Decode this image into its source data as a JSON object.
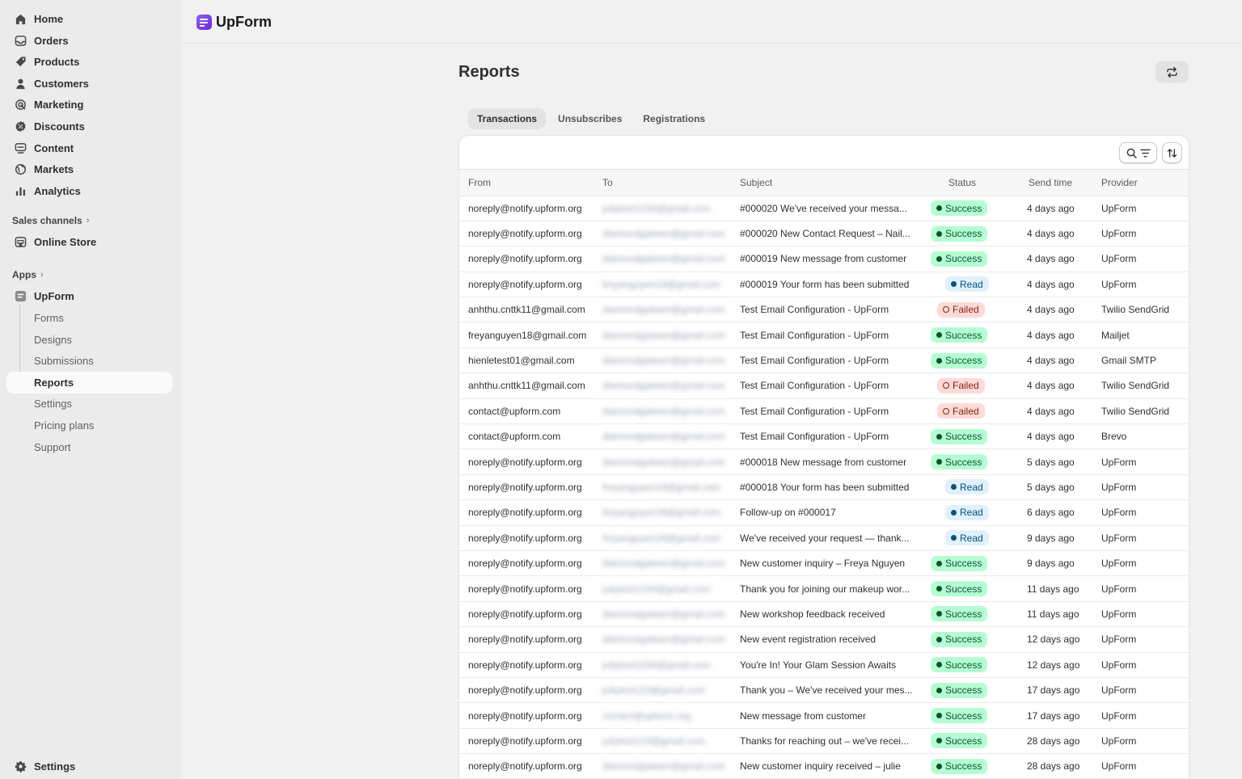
{
  "app": {
    "name": "UpForm"
  },
  "sidebar": {
    "main_items": [
      {
        "label": "Home",
        "icon": "home-icon"
      },
      {
        "label": "Orders",
        "icon": "inbox-icon"
      },
      {
        "label": "Products",
        "icon": "tag-icon"
      },
      {
        "label": "Customers",
        "icon": "person-icon"
      },
      {
        "label": "Marketing",
        "icon": "target-icon"
      },
      {
        "label": "Discounts",
        "icon": "discount-icon"
      },
      {
        "label": "Content",
        "icon": "content-icon"
      },
      {
        "label": "Markets",
        "icon": "globe-icon"
      },
      {
        "label": "Analytics",
        "icon": "bar-chart-icon"
      }
    ],
    "sales_channels_label": "Sales channels",
    "online_store_label": "Online Store",
    "apps_label": "Apps",
    "app_item_label": "UpForm",
    "app_sub_items": [
      "Forms",
      "Designs",
      "Submissions",
      "Reports",
      "Settings",
      "Pricing plans",
      "Support"
    ],
    "active_sub_item": "Reports",
    "settings_label": "Settings"
  },
  "page": {
    "title": "Reports",
    "tabs": [
      "Transactions",
      "Unsubscribes",
      "Registrations"
    ],
    "active_tab": "Transactions"
  },
  "table": {
    "headers": {
      "from": "From",
      "to": "To",
      "subject": "Subject",
      "status": "Status",
      "send_time": "Send time",
      "provider": "Provider"
    },
    "rows": [
      {
        "from": "noreply@notify.upform.org",
        "to": "juliytest1234@gmail.com",
        "subject": "#000020 We've received your messa...",
        "status": "Success",
        "send_time": "4 days ago",
        "provider": "UpForm"
      },
      {
        "from": "noreply@notify.upform.org",
        "to": "diamondgatewn@gmail.com",
        "subject": "#000020 New Contact Request – Nail...",
        "status": "Success",
        "send_time": "4 days ago",
        "provider": "UpForm"
      },
      {
        "from": "noreply@notify.upform.org",
        "to": "diamondgatewn@gmail.com",
        "subject": "#000019 New message from customer",
        "status": "Success",
        "send_time": "4 days ago",
        "provider": "UpForm"
      },
      {
        "from": "noreply@notify.upform.org",
        "to": "freyanguyen18@gmail.com",
        "subject": "#000019 Your form has been submitted",
        "status": "Read",
        "send_time": "4 days ago",
        "provider": "UpForm"
      },
      {
        "from": "anhthu.cnttk11@gmail.com",
        "to": "diamondgatewn@gmail.com",
        "subject": "Test Email Configuration - UpForm",
        "status": "Failed",
        "send_time": "4 days ago",
        "provider": "Twilio SendGrid"
      },
      {
        "from": "freyanguyen18@gmail.com",
        "to": "diamondgatewn@gmail.com",
        "subject": "Test Email Configuration - UpForm",
        "status": "Success",
        "send_time": "4 days ago",
        "provider": "Mailjet"
      },
      {
        "from": "hienletest01@gmail.com",
        "to": "diamondgatewn@gmail.com",
        "subject": "Test Email Configuration - UpForm",
        "status": "Success",
        "send_time": "4 days ago",
        "provider": "Gmail SMTP"
      },
      {
        "from": "anhthu.cnttk11@gmail.com",
        "to": "diamondgatewn@gmail.com",
        "subject": "Test Email Configuration - UpForm",
        "status": "Failed",
        "send_time": "4 days ago",
        "provider": "Twilio SendGrid"
      },
      {
        "from": "contact@upform.com",
        "to": "diamondgatewn@gmail.com",
        "subject": "Test Email Configuration - UpForm",
        "status": "Failed",
        "send_time": "4 days ago",
        "provider": "Twilio SendGrid"
      },
      {
        "from": "contact@upform.com",
        "to": "diamondgatewn@gmail.com",
        "subject": "Test Email Configuration - UpForm",
        "status": "Success",
        "send_time": "4 days ago",
        "provider": "Brevo"
      },
      {
        "from": "noreply@notify.upform.org",
        "to": "diamondgatewn@gmail.com",
        "subject": "#000018 New message from customer",
        "status": "Success",
        "send_time": "5 days ago",
        "provider": "UpForm"
      },
      {
        "from": "noreply@notify.upform.org",
        "to": "freyanguyen18@gmail.com",
        "subject": "#000018 Your form has been submitted",
        "status": "Read",
        "send_time": "5 days ago",
        "provider": "UpForm"
      },
      {
        "from": "noreply@notify.upform.org",
        "to": "freyanguyen18@gmail.com",
        "subject": "Follow-up on #000017",
        "status": "Read",
        "send_time": "6 days ago",
        "provider": "UpForm"
      },
      {
        "from": "noreply@notify.upform.org",
        "to": "freyanguyen18@gmail.com",
        "subject": "We've received your request — thank...",
        "status": "Read",
        "send_time": "9 days ago",
        "provider": "UpForm"
      },
      {
        "from": "noreply@notify.upform.org",
        "to": "diamondgatewn@gmail.com",
        "subject": "New customer inquiry – Freya Nguyen",
        "status": "Success",
        "send_time": "9 days ago",
        "provider": "UpForm"
      },
      {
        "from": "noreply@notify.upform.org",
        "to": "juliytest1234@gmail.com",
        "subject": "Thank you for joining our makeup wor...",
        "status": "Success",
        "send_time": "11 days ago",
        "provider": "UpForm"
      },
      {
        "from": "noreply@notify.upform.org",
        "to": "diamondgatewn@gmail.com",
        "subject": "New workshop feedback received",
        "status": "Success",
        "send_time": "11 days ago",
        "provider": "UpForm"
      },
      {
        "from": "noreply@notify.upform.org",
        "to": "diamondgatewn@gmail.com",
        "subject": "New event registration received",
        "status": "Success",
        "send_time": "12 days ago",
        "provider": "UpForm"
      },
      {
        "from": "noreply@notify.upform.org",
        "to": "juliytest1234@gmail.com",
        "subject": "You're In! Your Glam Session Awaits",
        "status": "Success",
        "send_time": "12 days ago",
        "provider": "UpForm"
      },
      {
        "from": "noreply@notify.upform.org",
        "to": "juliytest123@gmail.com",
        "subject": "Thank you – We've received your mes...",
        "status": "Success",
        "send_time": "17 days ago",
        "provider": "UpForm"
      },
      {
        "from": "noreply@notify.upform.org",
        "to": "contact@upform.org",
        "subject": "New message from customer",
        "status": "Success",
        "send_time": "17 days ago",
        "provider": "UpForm"
      },
      {
        "from": "noreply@notify.upform.org",
        "to": "juliytest123@gmail.com",
        "subject": "Thanks for reaching out – we've recei...",
        "status": "Success",
        "send_time": "28 days ago",
        "provider": "UpForm"
      },
      {
        "from": "noreply@notify.upform.org",
        "to": "diamondgatewn@gmail.com",
        "subject": "New customer inquiry received – julie",
        "status": "Success",
        "send_time": "28 days ago",
        "provider": "UpForm"
      }
    ]
  }
}
